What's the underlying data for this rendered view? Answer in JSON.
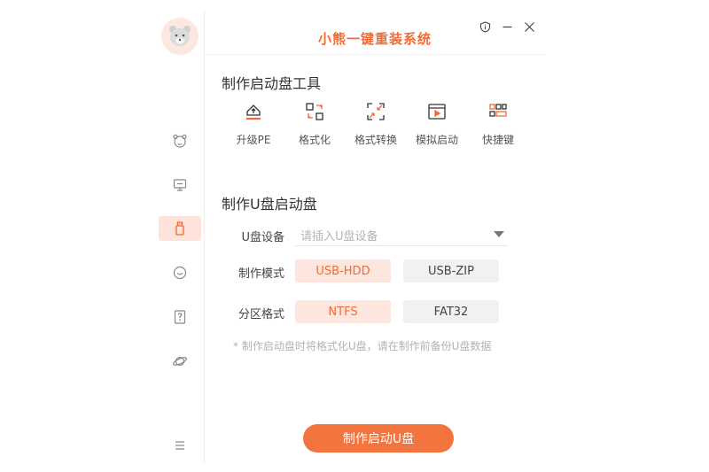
{
  "app": {
    "title": "小熊一键重装系统"
  },
  "colors": {
    "accent": "#f26b35",
    "accent_light": "#fde6dd",
    "muted": "#b2b2b2"
  },
  "sidebar": {
    "items": [
      {
        "icon": "bear-face-icon",
        "active": false
      },
      {
        "icon": "monitor-icon",
        "active": false
      },
      {
        "icon": "usb-drive-icon",
        "active": true
      },
      {
        "icon": "chat-bubble-icon",
        "active": false
      },
      {
        "icon": "help-book-icon",
        "active": false
      },
      {
        "icon": "planet-icon",
        "active": false
      }
    ],
    "menu_icon": "menu-icon"
  },
  "window_controls": [
    "info-shield-icon",
    "minimize-icon",
    "close-icon"
  ],
  "tools_section": {
    "title": "制作启动盘工具",
    "items": [
      {
        "label": "升级PE",
        "icon": "upgrade-pe-icon"
      },
      {
        "label": "格式化",
        "icon": "format-icon"
      },
      {
        "label": "格式转换",
        "icon": "convert-format-icon"
      },
      {
        "label": "模拟启动",
        "icon": "simulate-boot-icon"
      },
      {
        "label": "快捷键",
        "icon": "shortcut-keys-icon"
      }
    ]
  },
  "usb_section": {
    "title": "制作U盘启动盘",
    "device_label": "U盘设备",
    "device_placeholder": "请插入U盘设备",
    "mode_label": "制作模式",
    "modes": [
      {
        "label": "USB-HDD",
        "selected": true
      },
      {
        "label": "USB-ZIP",
        "selected": false
      }
    ],
    "partition_label": "分区格式",
    "partitions": [
      {
        "label": "NTFS",
        "selected": true
      },
      {
        "label": "FAT32",
        "selected": false
      }
    ],
    "note": "* 制作启动盘时将格式化U盘，请在制作前备份U盘数据",
    "action_button": "制作启动U盘"
  }
}
